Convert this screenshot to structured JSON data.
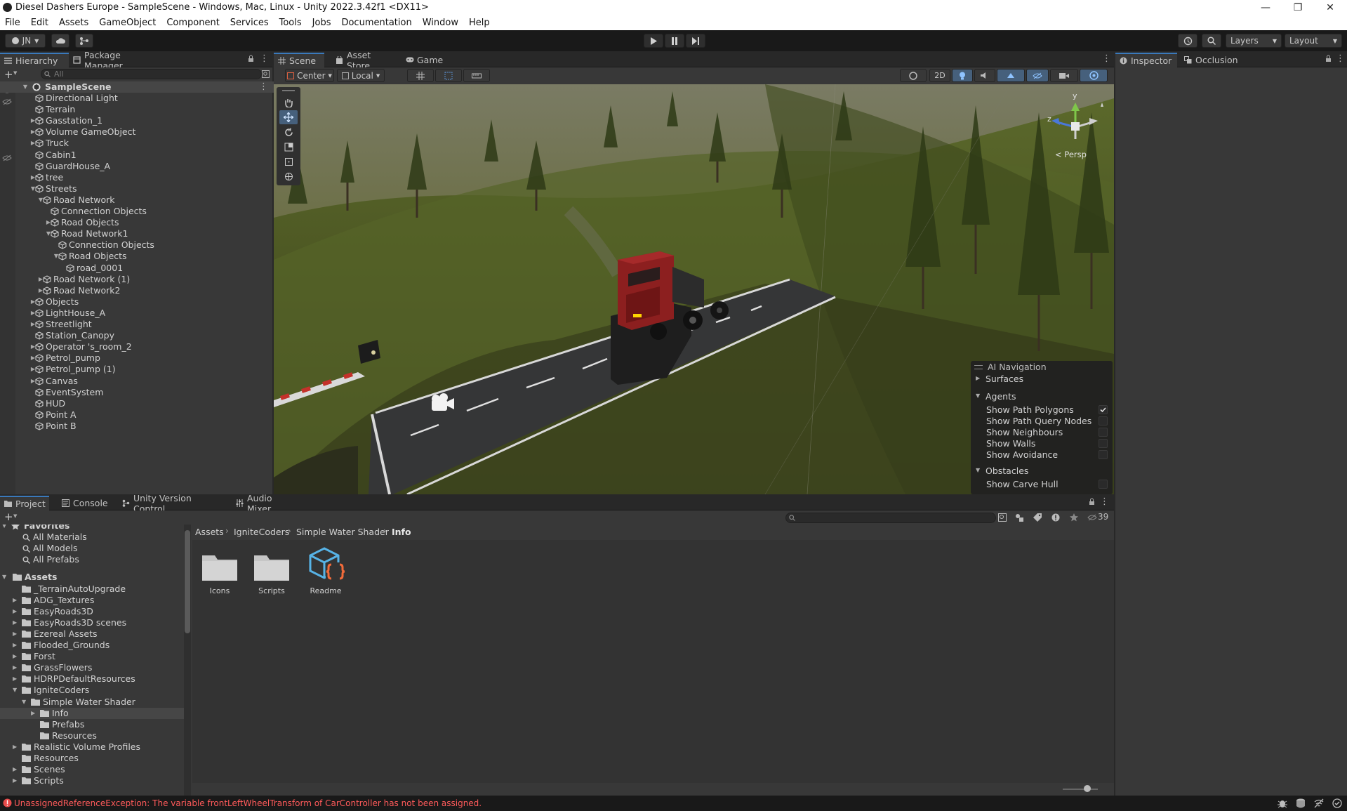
{
  "window": {
    "title": "Diesel Dashers Europe - SampleScene - Windows, Mac, Linux - Unity 2022.3.42f1 <DX11>"
  },
  "menu": [
    "File",
    "Edit",
    "Assets",
    "GameObject",
    "Component",
    "Services",
    "Tools",
    "Jobs",
    "Documentation",
    "Window",
    "Help"
  ],
  "toolbar": {
    "account": "JN",
    "layers": "Layers",
    "layout": "Layout"
  },
  "hierarchy": {
    "tabs": [
      "Hierarchy",
      "Package Manager"
    ],
    "search_placeholder": "All",
    "scene": "SampleScene",
    "items": [
      {
        "label": "Directional Light",
        "depth": 1,
        "arrow": ""
      },
      {
        "label": "Terrain",
        "depth": 1,
        "arrow": ""
      },
      {
        "label": "Gasstation_1",
        "depth": 1,
        "arrow": "right"
      },
      {
        "label": "Volume GameObject",
        "depth": 1,
        "arrow": "right"
      },
      {
        "label": "Truck",
        "depth": 1,
        "arrow": "right"
      },
      {
        "label": "Cabin1",
        "depth": 1,
        "arrow": ""
      },
      {
        "label": "GuardHouse_A",
        "depth": 1,
        "arrow": ""
      },
      {
        "label": "tree",
        "depth": 1,
        "arrow": "right"
      },
      {
        "label": "Streets",
        "depth": 1,
        "arrow": "down"
      },
      {
        "label": "Road Network",
        "depth": 2,
        "arrow": "down"
      },
      {
        "label": "Connection Objects",
        "depth": 3,
        "arrow": ""
      },
      {
        "label": "Road Objects",
        "depth": 3,
        "arrow": "right"
      },
      {
        "label": "Road Network1",
        "depth": 3,
        "arrow": "down"
      },
      {
        "label": "Connection Objects",
        "depth": 4,
        "arrow": ""
      },
      {
        "label": "Road Objects",
        "depth": 4,
        "arrow": "down"
      },
      {
        "label": "road_0001",
        "depth": 5,
        "arrow": ""
      },
      {
        "label": "Road Network (1)",
        "depth": 2,
        "arrow": "right"
      },
      {
        "label": "Road Network2",
        "depth": 2,
        "arrow": "right"
      },
      {
        "label": "Objects",
        "depth": 1,
        "arrow": "right"
      },
      {
        "label": "LightHouse_A",
        "depth": 1,
        "arrow": "right"
      },
      {
        "label": "Streetlight",
        "depth": 1,
        "arrow": "right"
      },
      {
        "label": "Station_Canopy",
        "depth": 1,
        "arrow": ""
      },
      {
        "label": "Operator 's_room_2",
        "depth": 1,
        "arrow": "right"
      },
      {
        "label": "Petrol_pump",
        "depth": 1,
        "arrow": "right"
      },
      {
        "label": "Petrol_pump (1)",
        "depth": 1,
        "arrow": "right"
      },
      {
        "label": "Canvas",
        "depth": 1,
        "arrow": "right"
      },
      {
        "label": "EventSystem",
        "depth": 1,
        "arrow": ""
      },
      {
        "label": "HUD",
        "depth": 1,
        "arrow": ""
      },
      {
        "label": "Point A",
        "depth": 1,
        "arrow": ""
      },
      {
        "label": "Point B",
        "depth": 1,
        "arrow": ""
      }
    ]
  },
  "scene_view": {
    "tabs": [
      "Scene",
      "Asset Store",
      "Game"
    ],
    "pivot": "Center",
    "space": "Local",
    "mode_2d": "2D",
    "gizmo_label": "< Persp",
    "axis_y": "y",
    "axis_z": "z"
  },
  "ai_nav": {
    "title": "AI Navigation",
    "surfaces": "Surfaces",
    "agents": "Agents",
    "agent_options": [
      {
        "label": "Show Path Polygons",
        "checked": true
      },
      {
        "label": "Show Path Query Nodes",
        "checked": false
      },
      {
        "label": "Show Neighbours",
        "checked": false
      },
      {
        "label": "Show Walls",
        "checked": false
      },
      {
        "label": "Show Avoidance",
        "checked": false
      }
    ],
    "obstacles": "Obstacles",
    "obstacle_options": [
      {
        "label": "Show Carve Hull",
        "checked": false
      }
    ]
  },
  "inspector": {
    "tabs": [
      "Inspector",
      "Occlusion"
    ]
  },
  "project": {
    "tabs": [
      "Project",
      "Console",
      "Unity Version Control",
      "Audio Mixer"
    ],
    "hidden_count": "39",
    "favorites_title": "Favorites",
    "favorites": [
      "All Materials",
      "All Models",
      "All Prefabs"
    ],
    "assets_title": "Assets",
    "tree": [
      {
        "label": "_TerrainAutoUpgrade",
        "depth": 1,
        "arrow": ""
      },
      {
        "label": "ADG_Textures",
        "depth": 1,
        "arrow": "right"
      },
      {
        "label": "EasyRoads3D",
        "depth": 1,
        "arrow": "right"
      },
      {
        "label": "EasyRoads3D scenes",
        "depth": 1,
        "arrow": "right"
      },
      {
        "label": "Ezereal Assets",
        "depth": 1,
        "arrow": "right"
      },
      {
        "label": "Flooded_Grounds",
        "depth": 1,
        "arrow": "right"
      },
      {
        "label": "Forst",
        "depth": 1,
        "arrow": "right"
      },
      {
        "label": "GrassFlowers",
        "depth": 1,
        "arrow": "right"
      },
      {
        "label": "HDRPDefaultResources",
        "depth": 1,
        "arrow": "right"
      },
      {
        "label": "IgniteCoders",
        "depth": 1,
        "arrow": "down"
      },
      {
        "label": "Simple Water Shader",
        "depth": 2,
        "arrow": "down"
      },
      {
        "label": "Info",
        "depth": 3,
        "arrow": "right",
        "selected": true
      },
      {
        "label": "Prefabs",
        "depth": 3,
        "arrow": ""
      },
      {
        "label": "Resources",
        "depth": 3,
        "arrow": ""
      },
      {
        "label": "Realistic Volume Profiles",
        "depth": 1,
        "arrow": "right"
      },
      {
        "label": "Resources",
        "depth": 1,
        "arrow": ""
      },
      {
        "label": "Scenes",
        "depth": 1,
        "arrow": "right"
      },
      {
        "label": "Scripts",
        "depth": 1,
        "arrow": "right"
      }
    ],
    "breadcrumb": [
      "Assets",
      "IgniteCoders",
      "Simple Water Shader",
      "Info"
    ],
    "grid": [
      {
        "label": "Icons",
        "icon": "folder-icon"
      },
      {
        "label": "Scripts",
        "icon": "folder-icon"
      },
      {
        "label": "Readme",
        "icon": "script-asset-icon"
      }
    ]
  },
  "status": {
    "error": "UnassignedReferenceException: The variable frontLeftWheelTransform of CarController has not been assigned."
  },
  "colors": {
    "accent": "#3a79bb",
    "panel": "#383838",
    "dark": "#282828",
    "error": "#ff5a5a"
  }
}
